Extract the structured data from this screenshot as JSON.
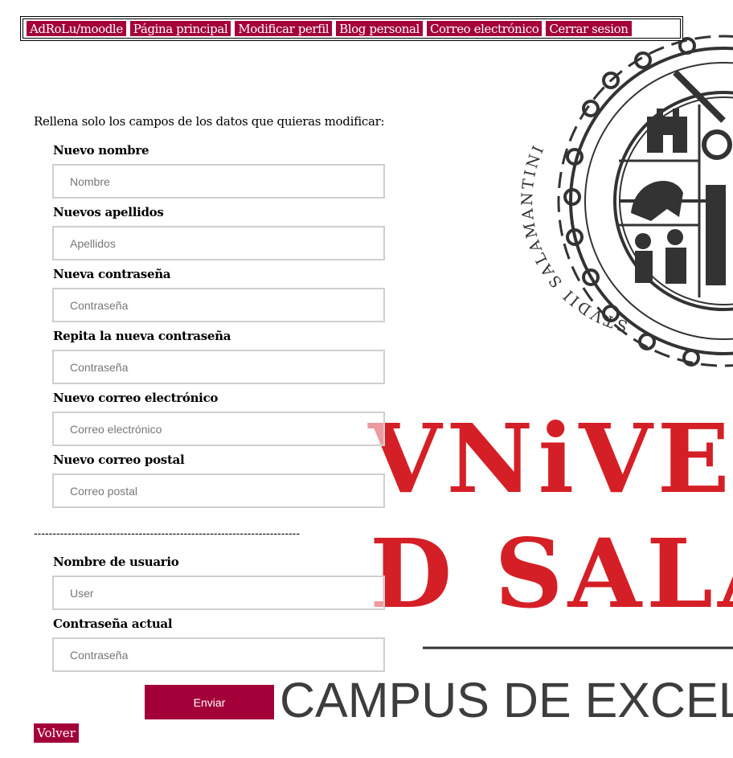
{
  "nav": {
    "items": [
      {
        "label": "AdRoLu/moodle"
      },
      {
        "label": "Página principal"
      },
      {
        "label": "Modificar perfil"
      },
      {
        "label": "Blog personal"
      },
      {
        "label": "Correo electrónico"
      },
      {
        "label": "Cerrar sesion"
      }
    ]
  },
  "form": {
    "intro": "Rellena solo los campos de los datos que quieras modificar:",
    "fields": [
      {
        "label": "Nuevo nombre",
        "placeholder": "Nombre",
        "value": ""
      },
      {
        "label": "Nuevos apellidos",
        "placeholder": "Apellidos",
        "value": ""
      },
      {
        "label": "Nueva contraseña",
        "placeholder": "Contraseña",
        "value": ""
      },
      {
        "label": "Repita la nueva contraseña",
        "placeholder": "Contraseña",
        "value": ""
      },
      {
        "label": "Nuevo correo electrónico",
        "placeholder": "Correo electrónico",
        "value": ""
      },
      {
        "label": "Nuevo correo postal",
        "placeholder": "Correo postal",
        "value": ""
      }
    ],
    "separator": "-----------------------------------------------------------------------",
    "auth_fields": [
      {
        "label": "Nombre de usuario",
        "placeholder": "User",
        "value": ""
      },
      {
        "label": "Contraseña actual",
        "placeholder": "Contraseña",
        "value": ""
      }
    ],
    "submit_label": "Enviar",
    "back_label": "Volver"
  },
  "background": {
    "seal_text": "STVDII SALAMANTINI",
    "line1": "VNiVE",
    "line2": "D SALA",
    "tagline": "CAMPUS DE EXCELEN",
    "seal_color": "#333333",
    "wordmark_color": "#d51f26"
  },
  "theme": {
    "accent": "#a3003a",
    "input_border": "#cfcfcf"
  }
}
